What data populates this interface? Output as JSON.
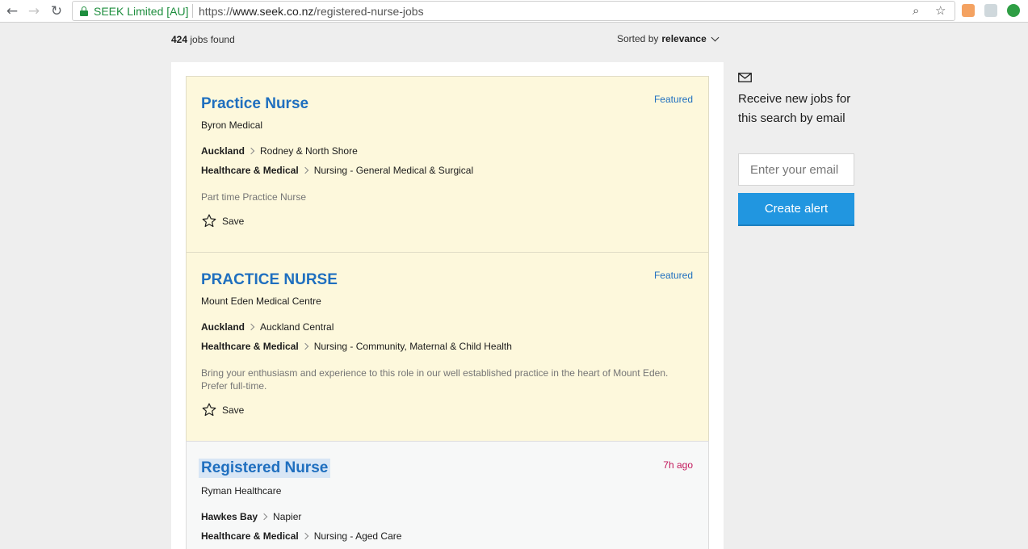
{
  "browser": {
    "site_name": "SEEK Limited [AU]",
    "url_scheme": "https://",
    "url_host": "www.seek.co.nz",
    "url_path": "/registered-nurse-jobs"
  },
  "results": {
    "count": "424",
    "count_suffix": " jobs found",
    "sort_prefix": "Sorted by ",
    "sort_value": "relevance"
  },
  "jobs": [
    {
      "title": "Practice Nurse",
      "badge": "Featured",
      "company": "Byron Medical",
      "location": "Auckland",
      "area": "Rodney & North Shore",
      "classification": "Healthcare & Medical",
      "subclassification": "Nursing - General Medical & Surgical",
      "description": "Part time Practice Nurse",
      "save_label": "Save"
    },
    {
      "title": "PRACTICE NURSE",
      "badge": "Featured",
      "company": "Mount Eden Medical Centre",
      "location": "Auckland",
      "area": "Auckland Central",
      "classification": "Healthcare & Medical",
      "subclassification": "Nursing - Community, Maternal & Child Health",
      "description": "Bring your enthusiasm and experience to this role in our well established practice in the heart of Mount Eden. Prefer full-time.",
      "save_label": "Save"
    },
    {
      "title": "Registered Nurse",
      "badge": "7h ago",
      "company": "Ryman Healthcare",
      "location": "Hawkes Bay",
      "area": "Napier",
      "classification": "Healthcare & Medical",
      "subclassification": "Nursing - Aged Care"
    }
  ],
  "alert": {
    "text": "Receive new jobs for this search by email",
    "email_placeholder": "Enter your email",
    "button_label": "Create alert"
  },
  "colors": {
    "link_blue": "#1f6fbf",
    "featured_bg": "#fdf8dc",
    "time_badge": "#c2185b",
    "button_blue": "#2196e0"
  }
}
